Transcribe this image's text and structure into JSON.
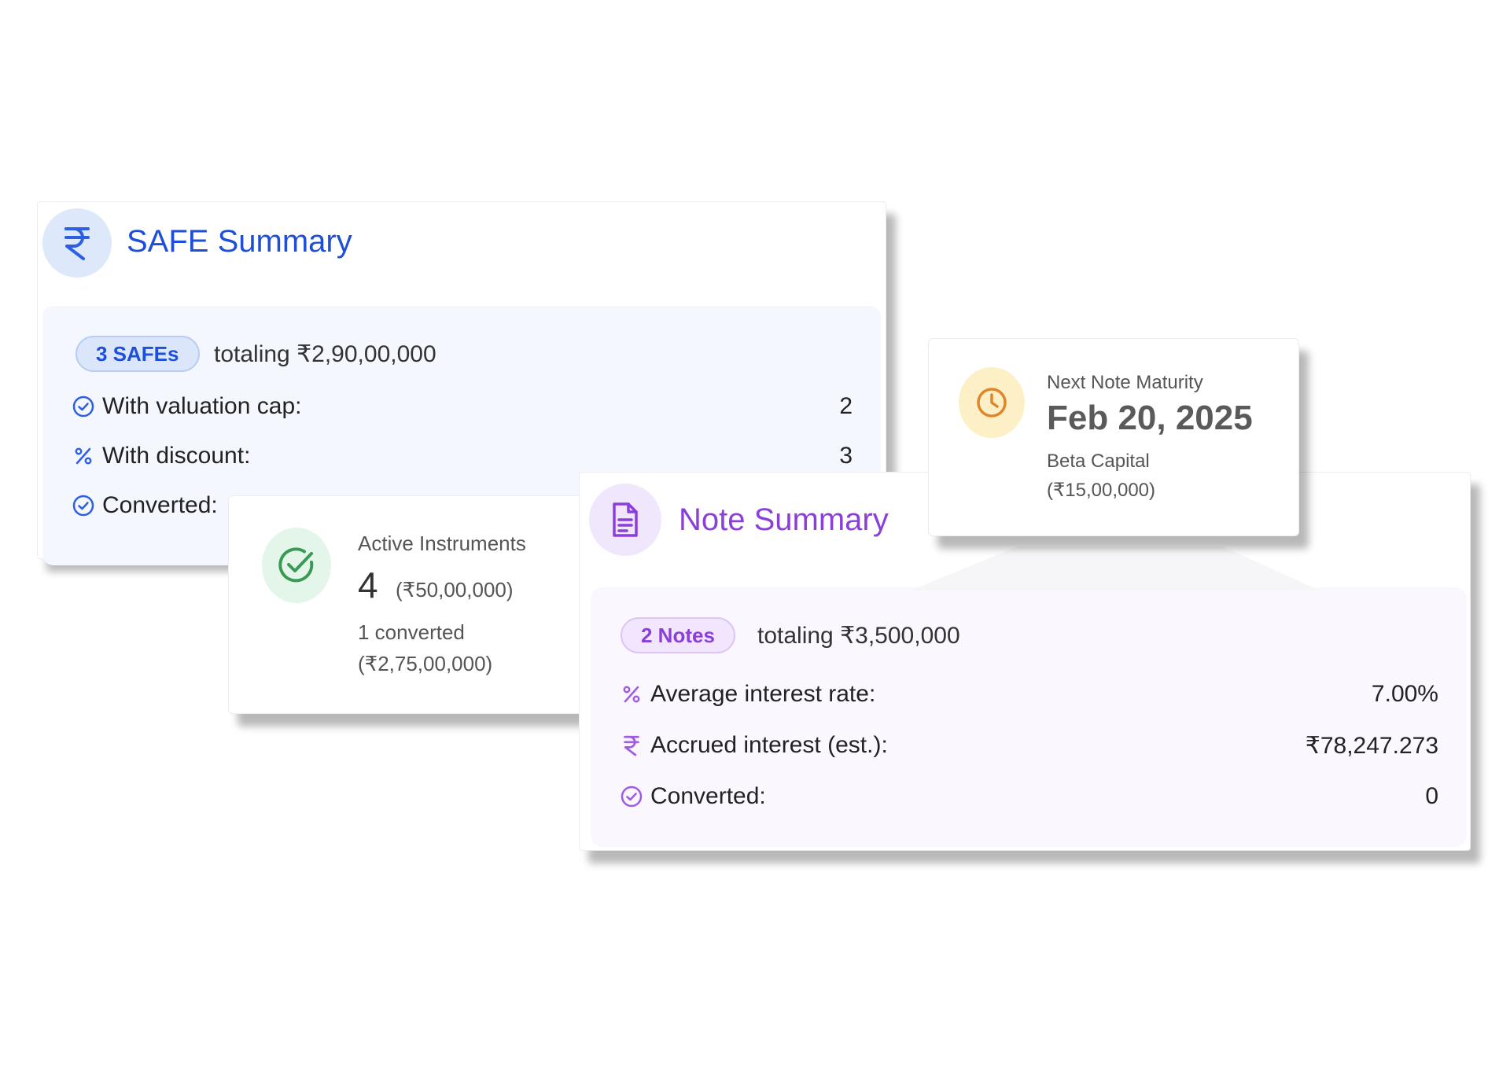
{
  "safe_summary": {
    "title": "SAFE Summary",
    "icon": "rupee-icon",
    "pill": "3 SAFEs",
    "total": "totaling ₹2,90,00,000",
    "rows": [
      {
        "icon": "check-circle-icon",
        "label": "With valuation cap:",
        "value": "2"
      },
      {
        "icon": "percent-icon",
        "label": "With discount:",
        "value": "3"
      },
      {
        "icon": "check-circle-icon",
        "label": "Converted:",
        "value": ""
      }
    ]
  },
  "active_instruments": {
    "icon": "check-circle-icon",
    "label": "Active Instruments",
    "count": "4",
    "amount": "(₹50,00,000)",
    "converted": "1 converted",
    "converted_amount": "(₹2,75,00,000)"
  },
  "note_summary": {
    "title": "Note Summary",
    "icon": "document-icon",
    "pill": "2 Notes",
    "total": "totaling ₹3,500,000",
    "rows": [
      {
        "icon": "percent-icon",
        "label": "Average interest rate:",
        "value": "7.00%"
      },
      {
        "icon": "rupee-icon",
        "label": "Accrued interest (est.):",
        "value": "₹78,247.273"
      },
      {
        "icon": "check-circle-icon",
        "label": "Converted:",
        "value": "0"
      }
    ]
  },
  "next_maturity": {
    "icon": "clock-icon",
    "label": "Next Note Maturity",
    "date": "Feb 20, 2025",
    "investor": "Beta Capital",
    "amount": "(₹15,00,000)"
  },
  "colors": {
    "safe_accent": "#1e4fd8",
    "note_accent": "#8b3fd9",
    "active_accent": "#3a9a55",
    "maturity_accent": "#e0852a"
  }
}
